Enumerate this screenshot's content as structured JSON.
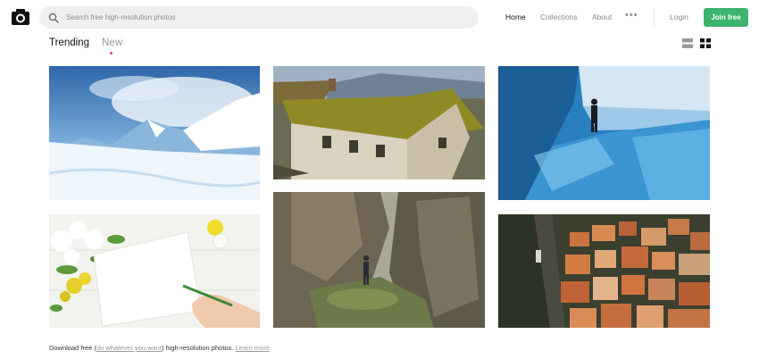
{
  "header": {
    "search_placeholder": "Search free high-resolution photos",
    "nav": [
      "Home",
      "Collections",
      "About"
    ],
    "more": "•••",
    "login": "Login",
    "join": "Join free"
  },
  "tabs": {
    "trending": "Trending",
    "new": "New"
  },
  "photos": [
    "snowy-mountain-landscape",
    "old-farmhouse-mossy-roof",
    "person-in-ice-cave",
    "notepad-with-flowers-and-hand",
    "hiker-between-cliffs",
    "hillside-town-aerial"
  ],
  "footer": {
    "prefix": "Download free",
    "open_paren": "(",
    "link": "do whatever you want",
    "close_paren": ")",
    "suffix": "high-resolution photos.",
    "learn_more": "Learn more"
  },
  "colors": {
    "accent": "#3cb46e",
    "tab_indicator": "#e8484e"
  }
}
